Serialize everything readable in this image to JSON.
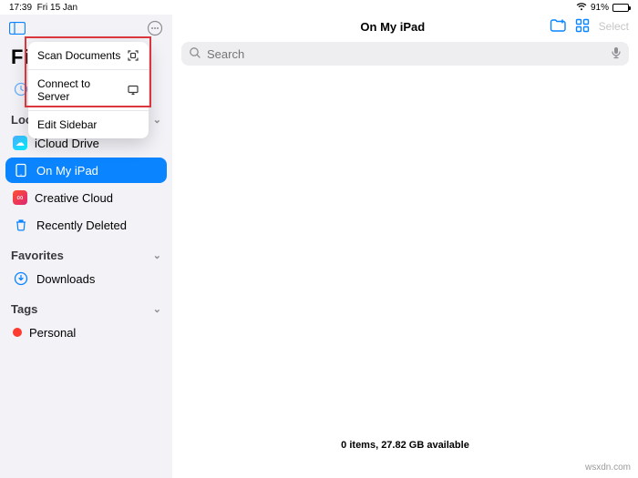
{
  "statusbar": {
    "time": "17:39",
    "date": "Fri 15 Jan",
    "wifi_icon": "wifi",
    "battery_pct": "91%"
  },
  "sidebar": {
    "title_truncated": "Fil",
    "recents_label": "R",
    "sections": {
      "locations": {
        "label": "Locations",
        "items": [
          {
            "label": "iCloud Drive"
          },
          {
            "label": "On My iPad"
          },
          {
            "label": "Creative Cloud"
          },
          {
            "label": "Recently Deleted"
          }
        ]
      },
      "favorites": {
        "label": "Favorites",
        "items": [
          {
            "label": "Downloads"
          }
        ]
      },
      "tags": {
        "label": "Tags",
        "items": [
          {
            "label": "Personal",
            "color": "#ff3b30"
          }
        ]
      }
    }
  },
  "popover": {
    "items": [
      {
        "label": "Scan Documents"
      },
      {
        "label": "Connect to Server"
      },
      {
        "label": "Edit Sidebar"
      }
    ]
  },
  "toolbar": {
    "title": "On My iPad",
    "select_label": "Select"
  },
  "search": {
    "placeholder": "Search"
  },
  "footer": {
    "status": "0 items, 27.82 GB available"
  },
  "watermark": "wsxdn.com"
}
